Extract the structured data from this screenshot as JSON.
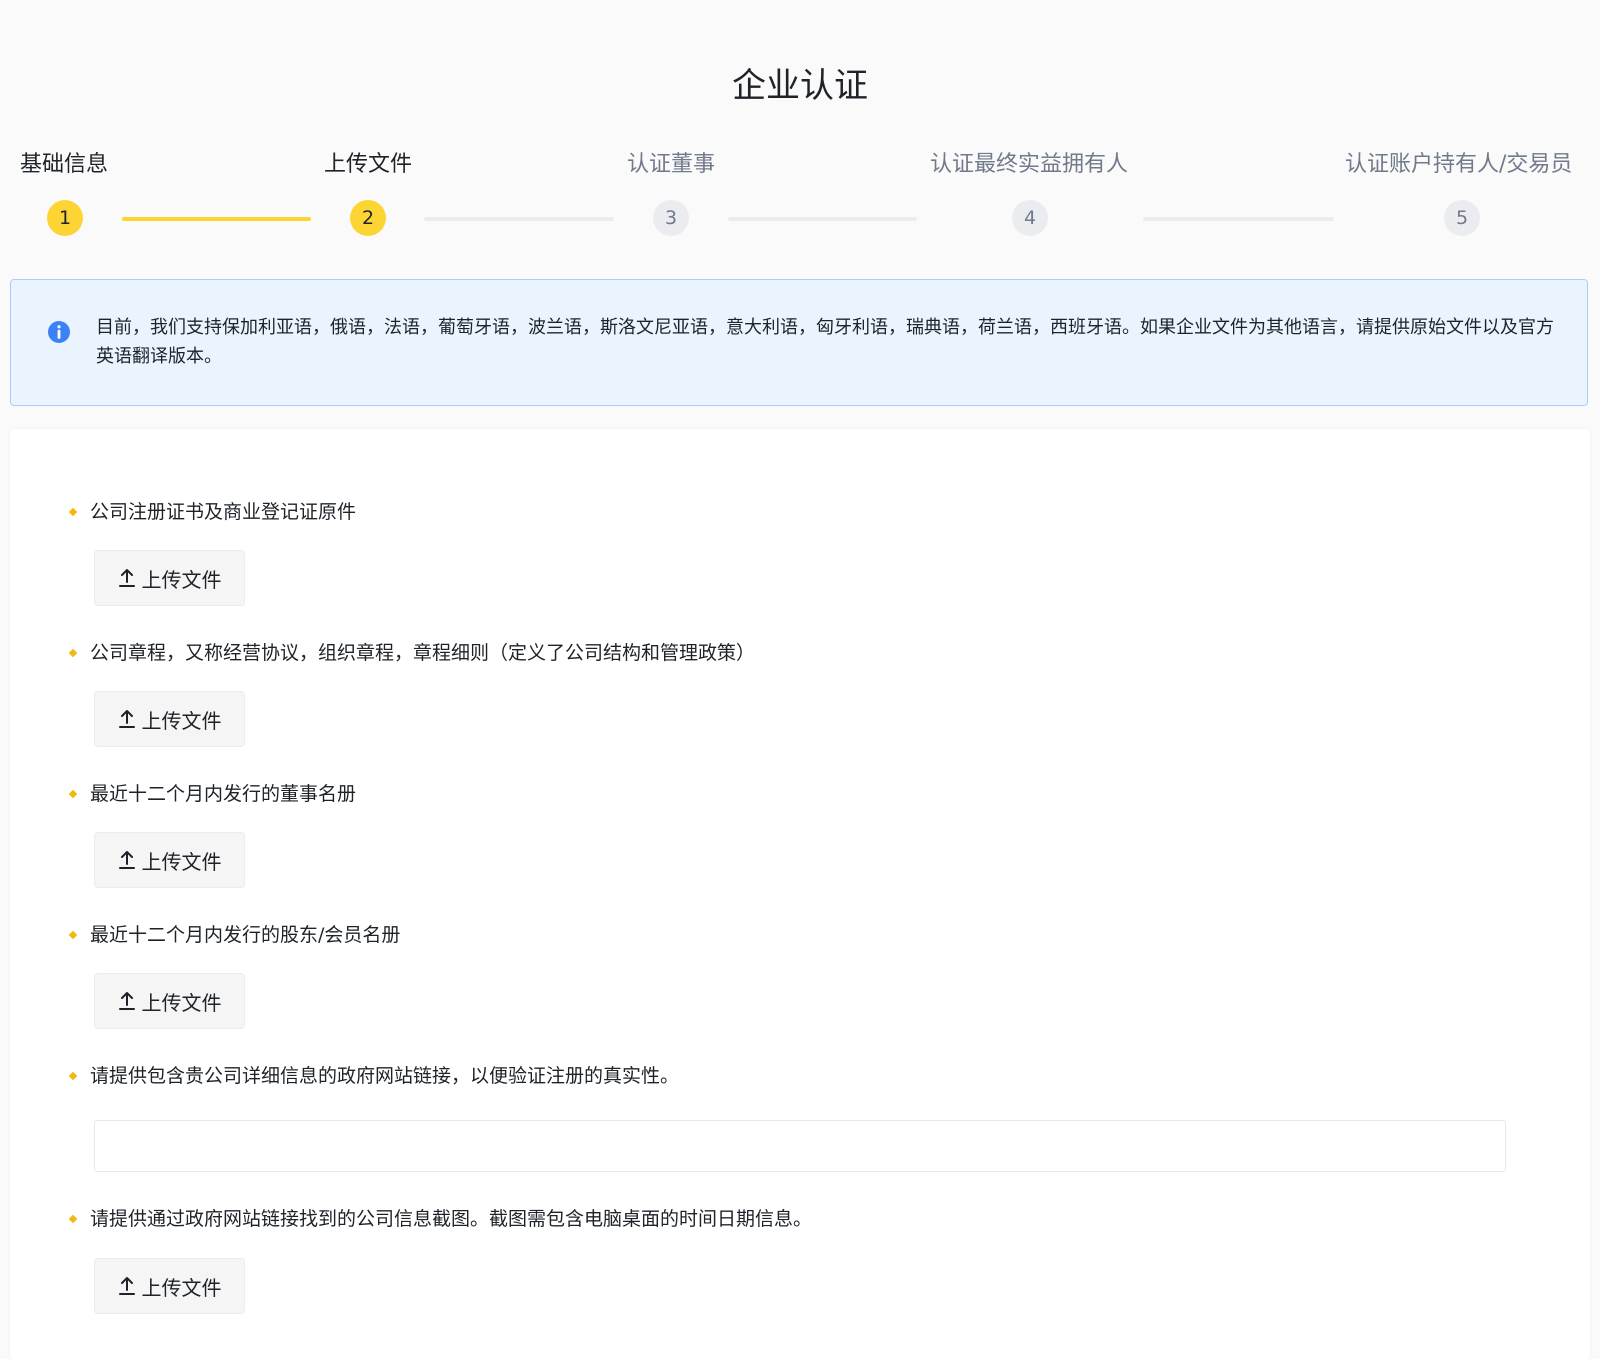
{
  "page": {
    "title": "企业认证"
  },
  "stepper": {
    "steps": [
      {
        "label": "基础信息",
        "number": "1",
        "status": "done"
      },
      {
        "label": "上传文件",
        "number": "2",
        "status": "active"
      },
      {
        "label": "认证董事",
        "number": "3",
        "status": "pending"
      },
      {
        "label": "认证最终实益拥有人",
        "number": "4",
        "status": "pending"
      },
      {
        "label": "认证账户持有人/交易员",
        "number": "5",
        "status": "pending"
      }
    ]
  },
  "notice": {
    "icon": "info-icon",
    "text": "目前，我们支持保加利亚语，俄语，法语，葡萄牙语，波兰语，斯洛文尼亚语，意大利语，匈牙利语，瑞典语，荷兰语，西班牙语。如果企业文件为其他语言，请提供原始文件以及官方英语翻译版本。"
  },
  "form": {
    "upload_label": "上传文件",
    "fields": [
      {
        "label": "公司注册证书及商业登记证原件",
        "type": "upload"
      },
      {
        "label": "公司章程，又称经营协议，组织章程，章程细则（定义了公司结构和管理政策）",
        "type": "upload"
      },
      {
        "label": "最近十二个月内发行的董事名册",
        "type": "upload"
      },
      {
        "label": "最近十二个月内发行的股东/会员名册",
        "type": "upload"
      },
      {
        "label": "请提供包含贵公司详细信息的政府网站链接，以便验证注册的真实性。",
        "type": "text",
        "value": "",
        "placeholder": ""
      },
      {
        "label": "请提供通过政府网站链接找到的公司信息截图。截图需包含电脑桌面的时间日期信息。",
        "type": "upload"
      }
    ]
  },
  "colors": {
    "accent": "#fcd535",
    "marker": "#f0b90b",
    "info": "#3b82f6",
    "pending": "#eaecef"
  }
}
